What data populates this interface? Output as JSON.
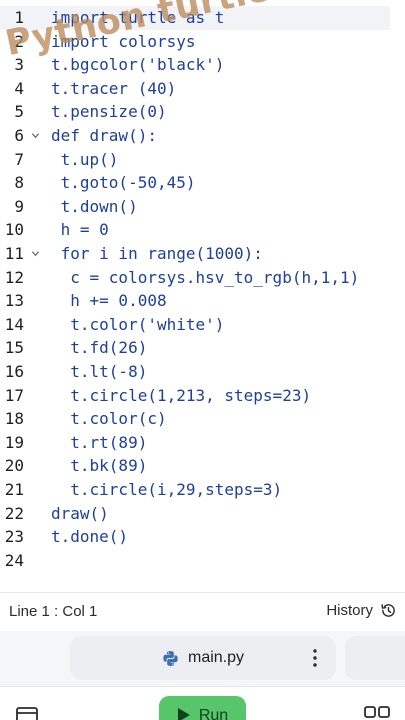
{
  "editor": {
    "lines": [
      {
        "num": "1",
        "text": "import turtle as t"
      },
      {
        "num": "2",
        "text": "import colorsys"
      },
      {
        "num": "3",
        "text": "t.bgcolor('black')"
      },
      {
        "num": "4",
        "text": "t.tracer (40)"
      },
      {
        "num": "5",
        "text": "t.pensize(0)"
      },
      {
        "num": "6",
        "text": "def draw():",
        "fold": true
      },
      {
        "num": "7",
        "text": " t.up()"
      },
      {
        "num": "8",
        "text": " t.goto(-50,45)"
      },
      {
        "num": "9",
        "text": " t.down()"
      },
      {
        "num": "10",
        "text": " h = 0"
      },
      {
        "num": "11",
        "text": " for i in range(1000):",
        "fold": true
      },
      {
        "num": "12",
        "text": "  c = colorsys.hsv_to_rgb(h,1,1)"
      },
      {
        "num": "13",
        "text": "  h += 0.008"
      },
      {
        "num": "14",
        "text": "  t.color('white')"
      },
      {
        "num": "15",
        "text": "  t.fd(26)"
      },
      {
        "num": "16",
        "text": "  t.lt(-8)"
      },
      {
        "num": "17",
        "text": "  t.circle(1,213, steps=23)"
      },
      {
        "num": "18",
        "text": "  t.color(c)"
      },
      {
        "num": "19",
        "text": "  t.rt(89)"
      },
      {
        "num": "20",
        "text": "  t.bk(89)"
      },
      {
        "num": "21",
        "text": "  t.circle(i,29,steps=3)"
      },
      {
        "num": "22",
        "text": "draw()"
      },
      {
        "num": "23",
        "text": "t.done()"
      },
      {
        "num": "24",
        "text": ""
      }
    ],
    "watermark": "Python turtle"
  },
  "status": {
    "cursor": "Line 1 : Col 1",
    "history_label": "History"
  },
  "tabs": {
    "file_name": "main.py",
    "file_icon": "python-logo-icon",
    "menu_icon": "kebab-menu-icon"
  },
  "toolbar": {
    "run_label": "Run",
    "left_icon": "panel-icon",
    "right_icon": "grid-icon"
  },
  "colors": {
    "code": "#1d3f9f",
    "line_numbers": "#1f1f1f",
    "active_line": "#f1f3f6",
    "watermark": "#ba8a5a",
    "run_button": "#57c66a"
  }
}
